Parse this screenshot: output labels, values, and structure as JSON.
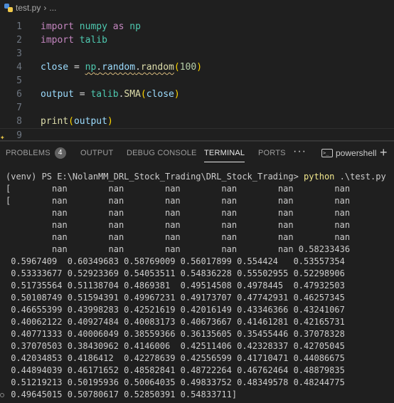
{
  "breadcrumb": {
    "file": "test.py",
    "separator": "›",
    "more": "..."
  },
  "editor": {
    "lines": [
      {
        "n": "1",
        "tokens": [
          [
            "kw",
            "import"
          ],
          [
            "op",
            " "
          ],
          [
            "mod",
            "numpy"
          ],
          [
            "op",
            " "
          ],
          [
            "kw",
            "as"
          ],
          [
            "op",
            " "
          ],
          [
            "mod",
            "np"
          ]
        ]
      },
      {
        "n": "2",
        "tokens": [
          [
            "kw",
            "import"
          ],
          [
            "op",
            " "
          ],
          [
            "mod",
            "talib"
          ]
        ]
      },
      {
        "n": "3",
        "tokens": []
      },
      {
        "n": "4",
        "tokens": [
          [
            "var",
            "close"
          ],
          [
            "op",
            " = "
          ],
          [
            "mod squiggle",
            "np"
          ],
          [
            "op squiggle",
            "."
          ],
          [
            "var squiggle",
            "random"
          ],
          [
            "op squiggle",
            "."
          ],
          [
            "fn squiggle",
            "random"
          ],
          [
            "brk1",
            "("
          ],
          [
            "num",
            "100"
          ],
          [
            "brk1",
            ")"
          ]
        ]
      },
      {
        "n": "5",
        "tokens": []
      },
      {
        "n": "6",
        "tokens": [
          [
            "var",
            "output"
          ],
          [
            "op",
            " = "
          ],
          [
            "mod",
            "talib"
          ],
          [
            "op",
            "."
          ],
          [
            "fn",
            "SMA"
          ],
          [
            "brk1",
            "("
          ],
          [
            "var",
            "close"
          ],
          [
            "brk1",
            ")"
          ]
        ]
      },
      {
        "n": "7",
        "tokens": []
      },
      {
        "n": "8",
        "tokens": [
          [
            "fn",
            "print"
          ],
          [
            "brk1",
            "("
          ],
          [
            "var",
            "output"
          ],
          [
            "brk1",
            ")"
          ]
        ]
      },
      {
        "n": "9",
        "tokens": []
      }
    ]
  },
  "panel": {
    "tabs": [
      {
        "label": "PROBLEMS",
        "badge": "4"
      },
      {
        "label": "OUTPUT"
      },
      {
        "label": "DEBUG CONSOLE"
      },
      {
        "label": "TERMINAL",
        "active": true
      },
      {
        "label": "PORTS"
      }
    ],
    "more_label": "···",
    "terminal_selector": "powershell",
    "new_terminal": "+"
  },
  "terminal": {
    "prompt": "(venv) PS E:\\NolanMM_DRL_Stock_Trading\\DRL_Stock_Trading>",
    "command": "python",
    "args": ".\\test.py",
    "output_lines": [
      "[        nan        nan        nan        nan        nan        nan",
      "[        nan        nan        nan        nan        nan        nan",
      "         nan        nan        nan        nan        nan        nan",
      "         nan        nan        nan        nan        nan        nan",
      "         nan        nan        nan        nan        nan        nan",
      "         nan        nan        nan        nan        nan 0.58233436",
      " 0.5967409  0.60349683 0.58769009 0.56017899 0.554424   0.53557354",
      " 0.53333677 0.52923369 0.54053511 0.54836228 0.55502955 0.52298906",
      " 0.51735564 0.51138704 0.4869381  0.49514508 0.4978445  0.47932503",
      " 0.50108749 0.51594391 0.49967231 0.49173707 0.47742931 0.46257345",
      " 0.46655399 0.43998283 0.42521619 0.42016149 0.43346366 0.43241067",
      " 0.40062122 0.40927484 0.40083173 0.40673667 0.41461281 0.42165731",
      " 0.40771333 0.40006049 0.38559366 0.36135605 0.35455446 0.37078328",
      " 0.37070503 0.38430962 0.4146006  0.42511406 0.42328337 0.42705045",
      " 0.42034853 0.4186412  0.42278639 0.42556599 0.41710471 0.44086675",
      " 0.44894039 0.46171652 0.48582841 0.48722264 0.46762464 0.48879835",
      " 0.51219213 0.50195936 0.50064035 0.49833752 0.48349578 0.48244775",
      " 0.49645015 0.50780617 0.52850391 0.54833711]"
    ]
  }
}
